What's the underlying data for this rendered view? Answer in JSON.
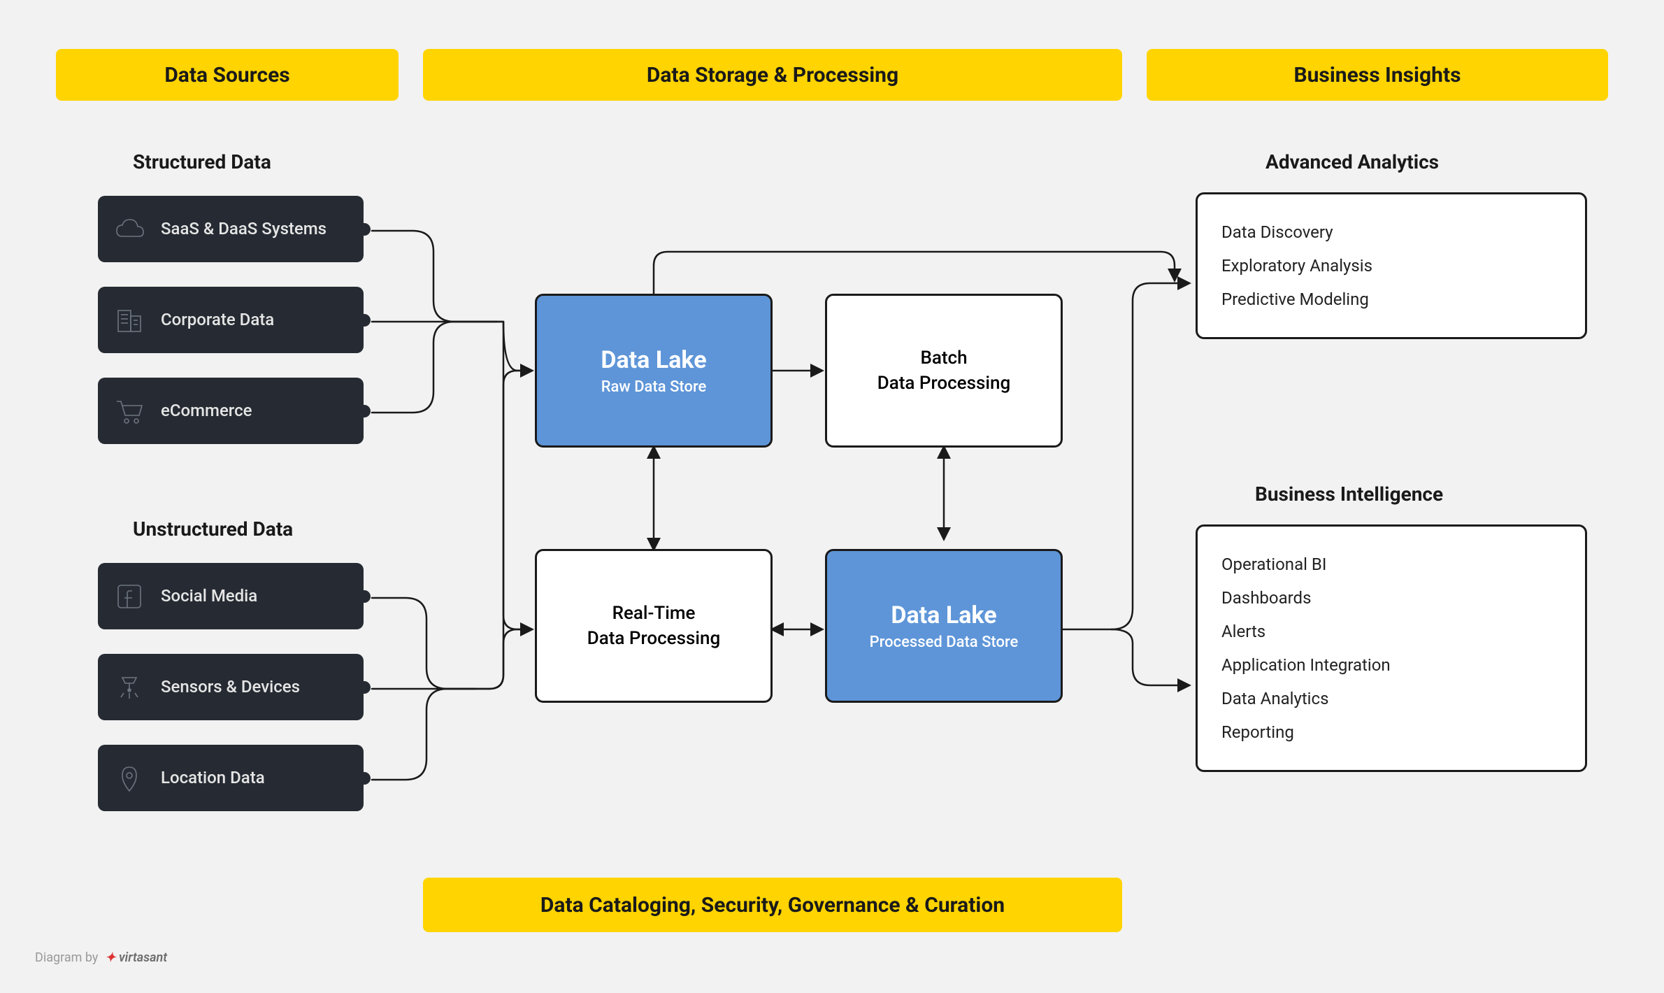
{
  "columns": {
    "sources": "Data Sources",
    "storage": "Data Storage & Processing",
    "insights": "Business Insights"
  },
  "sources": {
    "structured_heading": "Structured Data",
    "unstructured_heading": "Unstructured Data",
    "structured": [
      {
        "id": "saas",
        "label": "SaaS & DaaS Systems",
        "icon": "cloud-icon"
      },
      {
        "id": "corp",
        "label": "Corporate Data",
        "icon": "building-icon"
      },
      {
        "id": "ecom",
        "label": "eCommerce",
        "icon": "cart-icon"
      }
    ],
    "unstructured": [
      {
        "id": "social",
        "label": "Social Media",
        "icon": "facebook-icon"
      },
      {
        "id": "sensors",
        "label": "Sensors & Devices",
        "icon": "sensor-icon"
      },
      {
        "id": "location",
        "label": "Location Data",
        "icon": "pin-icon"
      }
    ]
  },
  "processing": {
    "raw_lake": {
      "title": "Data Lake",
      "subtitle": "Raw Data Store"
    },
    "batch": {
      "line1": "Batch",
      "line2": "Data Processing"
    },
    "realtime": {
      "line1": "Real-Time",
      "line2": "Data Processing"
    },
    "proc_lake": {
      "title": "Data Lake",
      "subtitle": "Processed Data Store"
    }
  },
  "insights": {
    "advanced_heading": "Advanced Analytics",
    "advanced_items": [
      "Data Discovery",
      "Exploratory Analysis",
      "Predictive Modeling"
    ],
    "bi_heading": "Business Intelligence",
    "bi_items": [
      "Operational BI",
      "Dashboards",
      "Alerts",
      "Application Integration",
      "Data Analytics",
      "Reporting"
    ]
  },
  "footer": "Data Cataloging, Security, Governance & Curation",
  "attribution": {
    "prefix": "Diagram by",
    "brand": "virtasant"
  },
  "colors": {
    "yellow": "#FFD400",
    "blue": "#5E95D8",
    "dark": "#262B33",
    "stroke": "#1a1a1a",
    "bg": "#f2f2f2"
  }
}
